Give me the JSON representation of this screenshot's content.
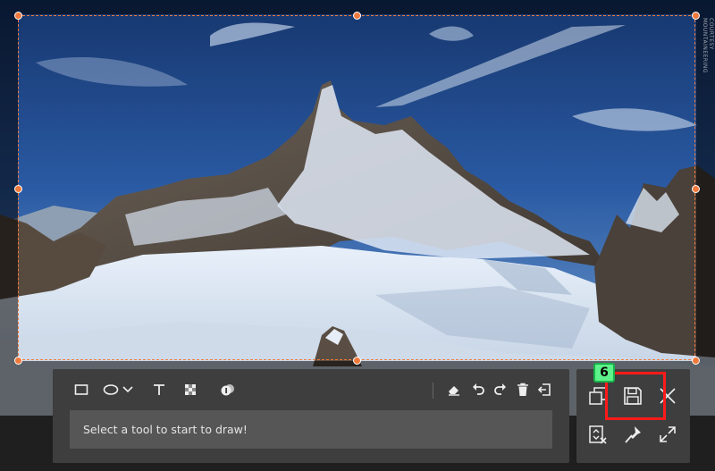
{
  "watermark": "COURTESY MOUNTAINEERING",
  "toolbar": {
    "tools": [
      {
        "name": "rectangle-tool",
        "icon": "rectangle-icon"
      },
      {
        "name": "ellipse-tool",
        "icon": "ellipse-icon"
      },
      {
        "name": "arrow-dropdown-tool",
        "icon": "chevron-down-icon"
      },
      {
        "name": "text-tool",
        "icon": "text-icon"
      },
      {
        "name": "mosaic-tool",
        "icon": "mosaic-icon"
      },
      {
        "name": "number-marker-tool",
        "icon": "number-marker-icon"
      },
      {
        "name": "eraser-tool",
        "icon": "eraser-icon"
      },
      {
        "name": "undo-tool",
        "icon": "undo-icon"
      },
      {
        "name": "redo-tool",
        "icon": "redo-icon"
      },
      {
        "name": "delete-tool",
        "icon": "trash-icon"
      },
      {
        "name": "exit-draw-tool",
        "icon": "exit-icon"
      }
    ],
    "hint": "Select a tool to start to draw!"
  },
  "actions": {
    "items": [
      {
        "name": "copy-button",
        "icon": "copy-icon"
      },
      {
        "name": "save-button",
        "icon": "floppy-disk-icon"
      },
      {
        "name": "close-button",
        "icon": "close-icon"
      },
      {
        "name": "scroll-capture-button",
        "icon": "scroll-capture-icon"
      },
      {
        "name": "pin-button",
        "icon": "pin-icon"
      },
      {
        "name": "fullscreen-button",
        "icon": "expand-icon"
      }
    ]
  },
  "annotation": {
    "badge_number": "6",
    "badge_color": "#5df28a",
    "highlight_color": "#ff1a1a"
  },
  "colors": {
    "selection_handle": "#f07a3c",
    "panel_background": "#3e3e3e",
    "hint_background": "#565656"
  }
}
